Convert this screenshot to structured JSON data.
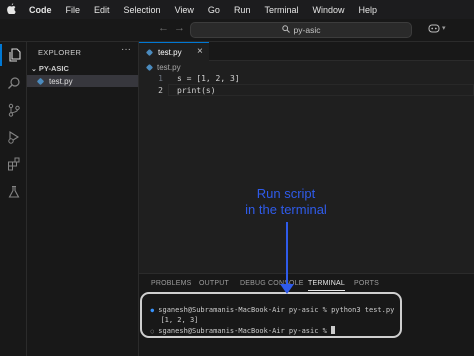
{
  "menubar": {
    "apple_glyph": "",
    "items": [
      "Code",
      "File",
      "Edit",
      "Selection",
      "View",
      "Go",
      "Run",
      "Terminal",
      "Window",
      "Help"
    ]
  },
  "titlebar": {
    "back_arrow": "←",
    "forward_arrow": "→",
    "search_text": "py-asic"
  },
  "sidebar": {
    "title": "EXPLORER",
    "more": "···",
    "folder": "PY-ASIC",
    "file": "test.py"
  },
  "editor": {
    "tab_label": "test.py",
    "tab_close": "×",
    "breadcrumb": "test.py",
    "lines": [
      {
        "number": "1",
        "text": "s = [1, 2, 3]"
      },
      {
        "number": "2",
        "text": "print(s)"
      }
    ]
  },
  "annotation": {
    "line1": "Run script",
    "line2": "in the terminal"
  },
  "panel": {
    "tabs": [
      "PROBLEMS",
      "OUTPUT",
      "DEBUG CONSOLE",
      "TERMINAL",
      "PORTS"
    ],
    "active_tab": "TERMINAL"
  },
  "terminal": {
    "prompt1": "sganesh@Subramanis-MacBook-Air py-asic % python3 test.py",
    "output": "[1, 2, 3]",
    "prompt2": "sganesh@Subramanis-MacBook-Air py-asic % "
  },
  "colors": {
    "accent": "#0078d4",
    "annotation": "#2f5bea",
    "python_icon": "#4b8bbe"
  }
}
